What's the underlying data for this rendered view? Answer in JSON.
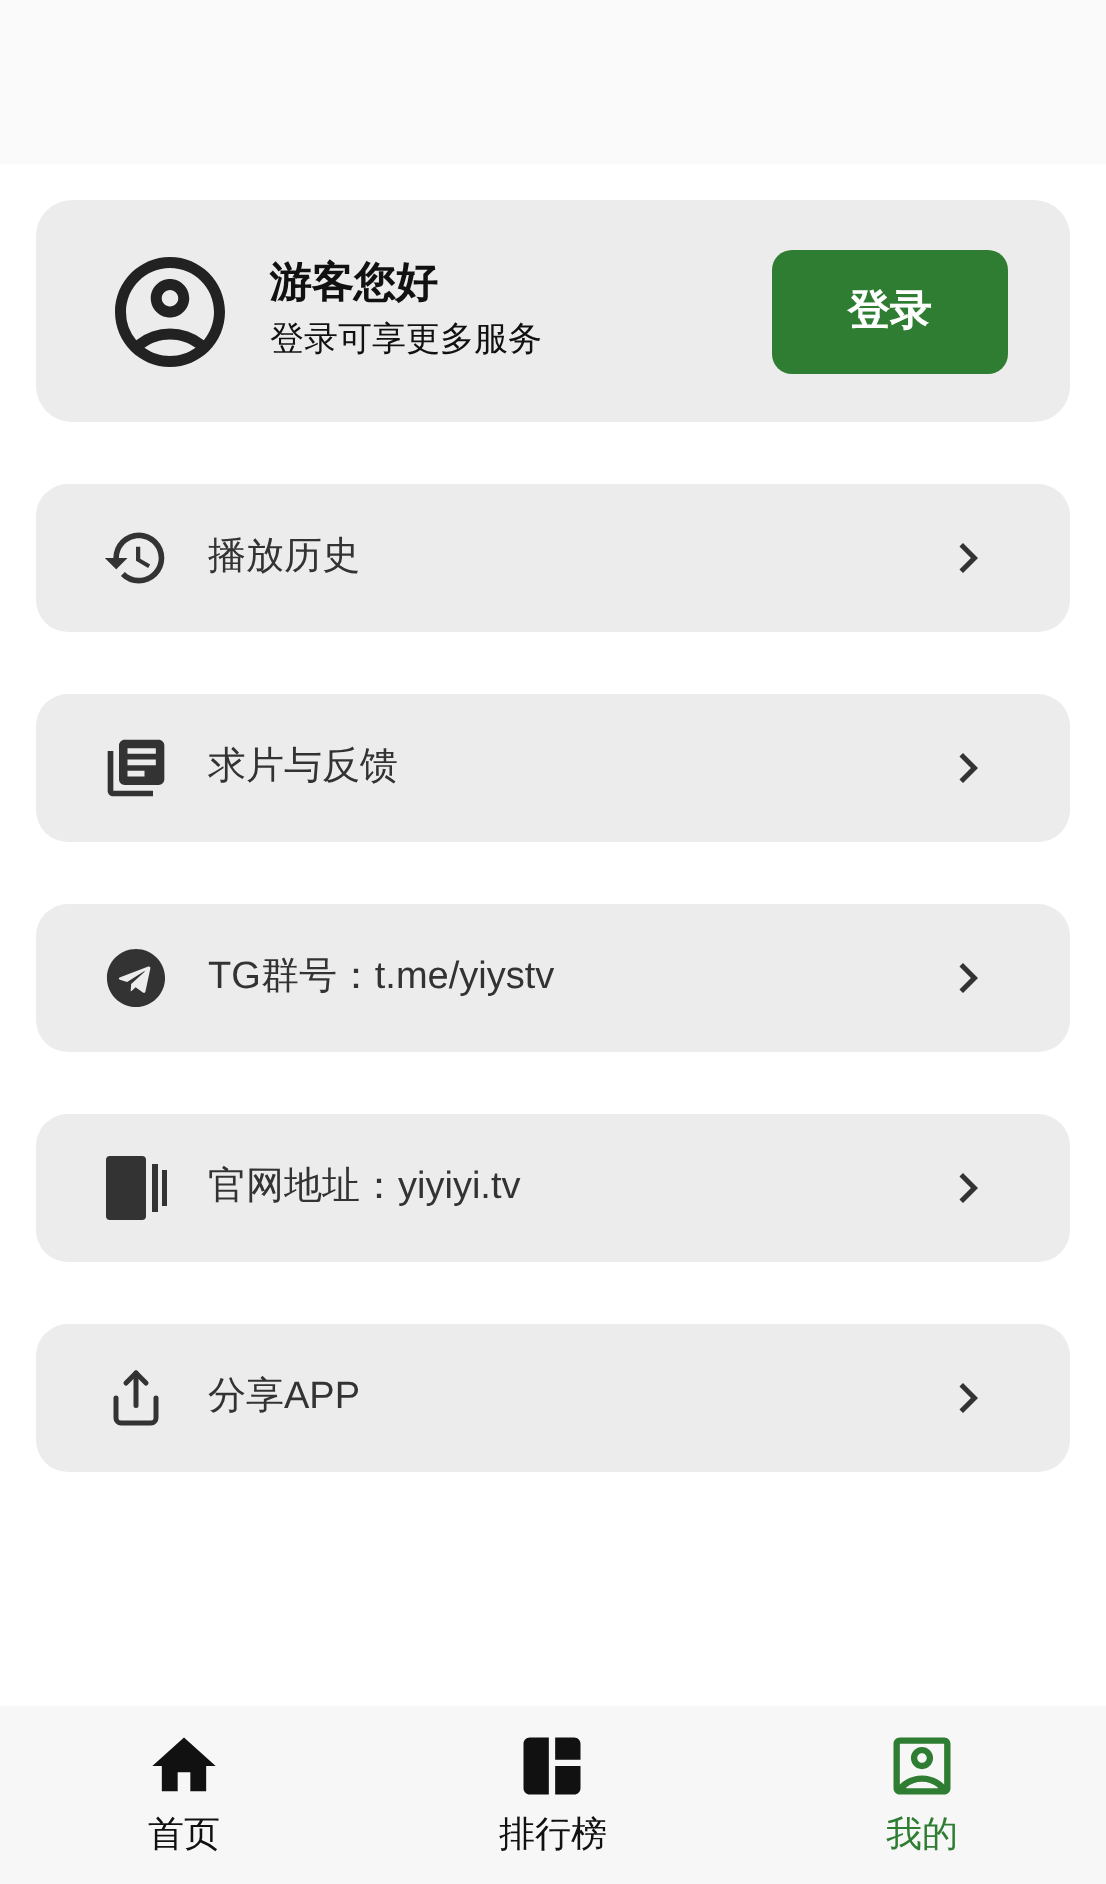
{
  "profile": {
    "title": "游客您好",
    "subtitle": "登录可享更多服务",
    "login_button": "登录"
  },
  "menu": [
    {
      "kind": "history",
      "label": "播放历史"
    },
    {
      "kind": "feedback",
      "label": "求片与反馈"
    },
    {
      "kind": "telegram",
      "label": "TG群号：t.me/yiystv"
    },
    {
      "kind": "website",
      "label": "官网地址：yiyiyi.tv"
    },
    {
      "kind": "share",
      "label": "分享APP"
    }
  ],
  "bottom_nav": [
    {
      "kind": "home",
      "label": "首页",
      "selected": false
    },
    {
      "kind": "ranking",
      "label": "排行榜",
      "selected": false
    },
    {
      "kind": "mine",
      "label": "我的",
      "selected": true
    }
  ]
}
